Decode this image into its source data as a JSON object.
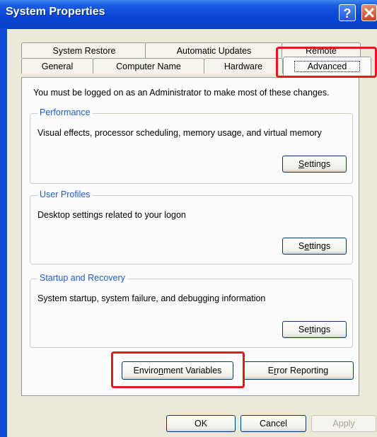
{
  "window": {
    "title": "System Properties"
  },
  "tabs_back": [
    "System Restore",
    "Automatic Updates",
    "Remote"
  ],
  "tabs_front": [
    "General",
    "Computer Name",
    "Hardware",
    "Advanced"
  ],
  "notice": "You must be logged on as an Administrator to make most of these changes.",
  "groups": {
    "performance": {
      "title": "Performance",
      "desc": "Visual effects, processor scheduling, memory usage, and virtual memory",
      "button_pre": "",
      "button_u": "S",
      "button_post": "ettings"
    },
    "user_profiles": {
      "title": "User Profiles",
      "desc": "Desktop settings related to your logon",
      "button_pre": "S",
      "button_u": "e",
      "button_post": "ttings"
    },
    "startup": {
      "title": "Startup and Recovery",
      "desc": "System startup, system failure, and debugging information",
      "button_pre": "Se",
      "button_u": "t",
      "button_post": "tings"
    }
  },
  "env_button": {
    "pre": "Enviro",
    "u": "n",
    "post": "ment Variables"
  },
  "error_button": {
    "pre": "E",
    "u": "r",
    "post": "ror Reporting"
  },
  "footer": {
    "ok": "OK",
    "cancel": "Cancel",
    "apply": "Apply"
  },
  "icons": {
    "help": "question-mark",
    "close": "x-mark"
  },
  "colors": {
    "titlebar": "#0a46d6",
    "highlight": "#e5191d",
    "group_title": "#1f5bc4",
    "dialog_bg": "#ece9d8"
  }
}
